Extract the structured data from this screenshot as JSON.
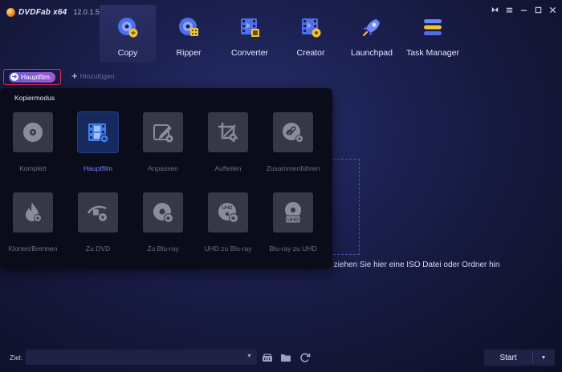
{
  "app": {
    "logo_text": "DVDFab x64",
    "version": "12.0.1.5"
  },
  "window_controls": [
    "ribbon-icon",
    "menu-icon",
    "minimize-icon",
    "maximize-icon",
    "close-icon"
  ],
  "nav": [
    {
      "label": "Copy",
      "icon": "disc-copy-icon",
      "active": true
    },
    {
      "label": "Ripper",
      "icon": "disc-ripper-icon",
      "active": false
    },
    {
      "label": "Converter",
      "icon": "film-converter-icon",
      "active": false
    },
    {
      "label": "Creator",
      "icon": "film-creator-icon",
      "active": false
    },
    {
      "label": "Launchpad",
      "icon": "rocket-icon",
      "active": false
    },
    {
      "label": "Task Manager",
      "icon": "list-icon",
      "active": false
    }
  ],
  "subbar": {
    "mode_label": "Hauptfilm",
    "add_label": "Hinzufügen"
  },
  "dropdown": {
    "title": "Kopiermodus",
    "tiles": [
      {
        "label": "Komplett",
        "icon": "disc-icon",
        "active": false
      },
      {
        "label": "Hauptfilm",
        "icon": "film-icon",
        "active": true
      },
      {
        "label": "Anpassen",
        "icon": "edit-icon",
        "active": false
      },
      {
        "label": "Aufteilen",
        "icon": "crop-icon",
        "active": false
      },
      {
        "label": "Zusammenführen",
        "icon": "link-disc-icon",
        "active": false
      },
      {
        "label": "Klonen/Brennen",
        "icon": "flame-icon",
        "active": false
      },
      {
        "label": "Zu DVD",
        "icon": "bluray-icon",
        "active": false
      },
      {
        "label": "Zu Blu-ray",
        "icon": "disc-bluray-icon",
        "active": false
      },
      {
        "label": "UHD zu Blu-ray",
        "icon": "uhd-disc-icon",
        "active": false
      },
      {
        "label": "Blu-ray zu UHD",
        "icon": "uhd-output-icon",
        "active": false
      }
    ]
  },
  "drop_hint": "er ziehen Sie hier eine ISO Datei oder Ordner hin",
  "bottom": {
    "ziel_label": "Ziel:",
    "ziel_value": "",
    "icons": [
      "iso-icon",
      "folder-icon",
      "refresh-icon"
    ],
    "start_label": "Start"
  },
  "colors": {
    "accent": "#6f86ff",
    "active_tile": "#172a5e",
    "highlight_border": "#e0304a"
  }
}
